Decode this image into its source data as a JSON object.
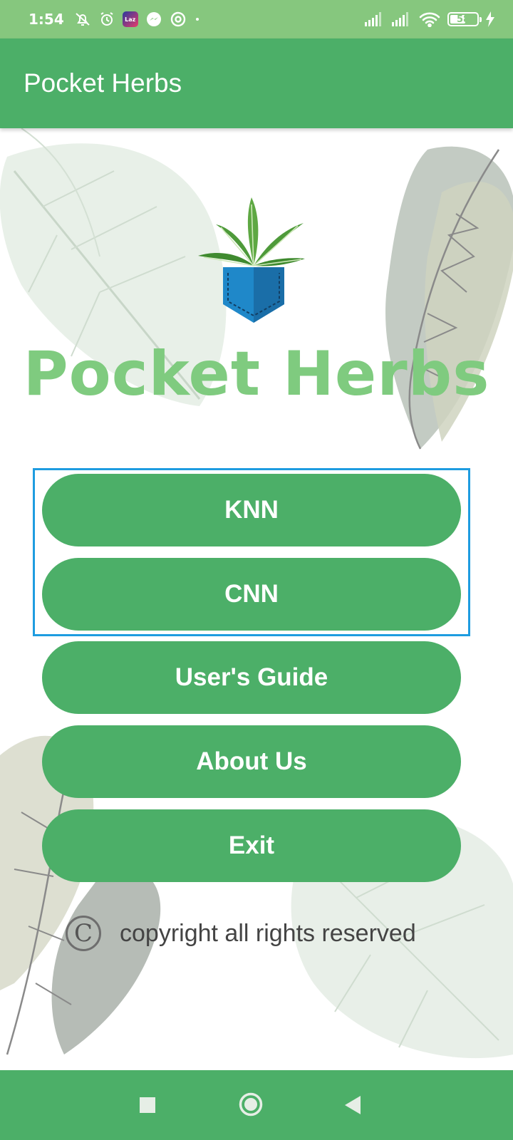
{
  "status_bar": {
    "time": "1:54",
    "icons_left": [
      "alarm-off-icon",
      "alarm-icon",
      "lazada-icon",
      "messenger-icon",
      "at-sign-icon",
      "dot-icon"
    ],
    "lazada_label": "Laz",
    "icons_right": [
      "signal-icon",
      "signal-icon",
      "wifi-icon",
      "battery-icon",
      "charging-icon"
    ],
    "battery": "58",
    "battery_level": 0.58
  },
  "app_bar": {
    "title": "Pocket Herbs"
  },
  "logo": {
    "text": "Pocket Herbs",
    "icon": "pocket-herb-logo"
  },
  "buttons": [
    {
      "id": "knn",
      "label": "KNN"
    },
    {
      "id": "cnn",
      "label": "CNN"
    },
    {
      "id": "guide",
      "label": "User's Guide"
    },
    {
      "id": "about",
      "label": "About Us"
    },
    {
      "id": "exit",
      "label": "Exit"
    }
  ],
  "footer": {
    "copyright_symbol": "C",
    "copyright_text": "copyright all rights reserved"
  },
  "nav_bar": {
    "icons": [
      "recent-apps-icon",
      "home-icon",
      "back-icon"
    ]
  },
  "colors": {
    "status_bar": "#86c77e",
    "primary": "#4caf68",
    "logo_text": "#7fcb7f",
    "highlight": "#1e9ce0"
  }
}
